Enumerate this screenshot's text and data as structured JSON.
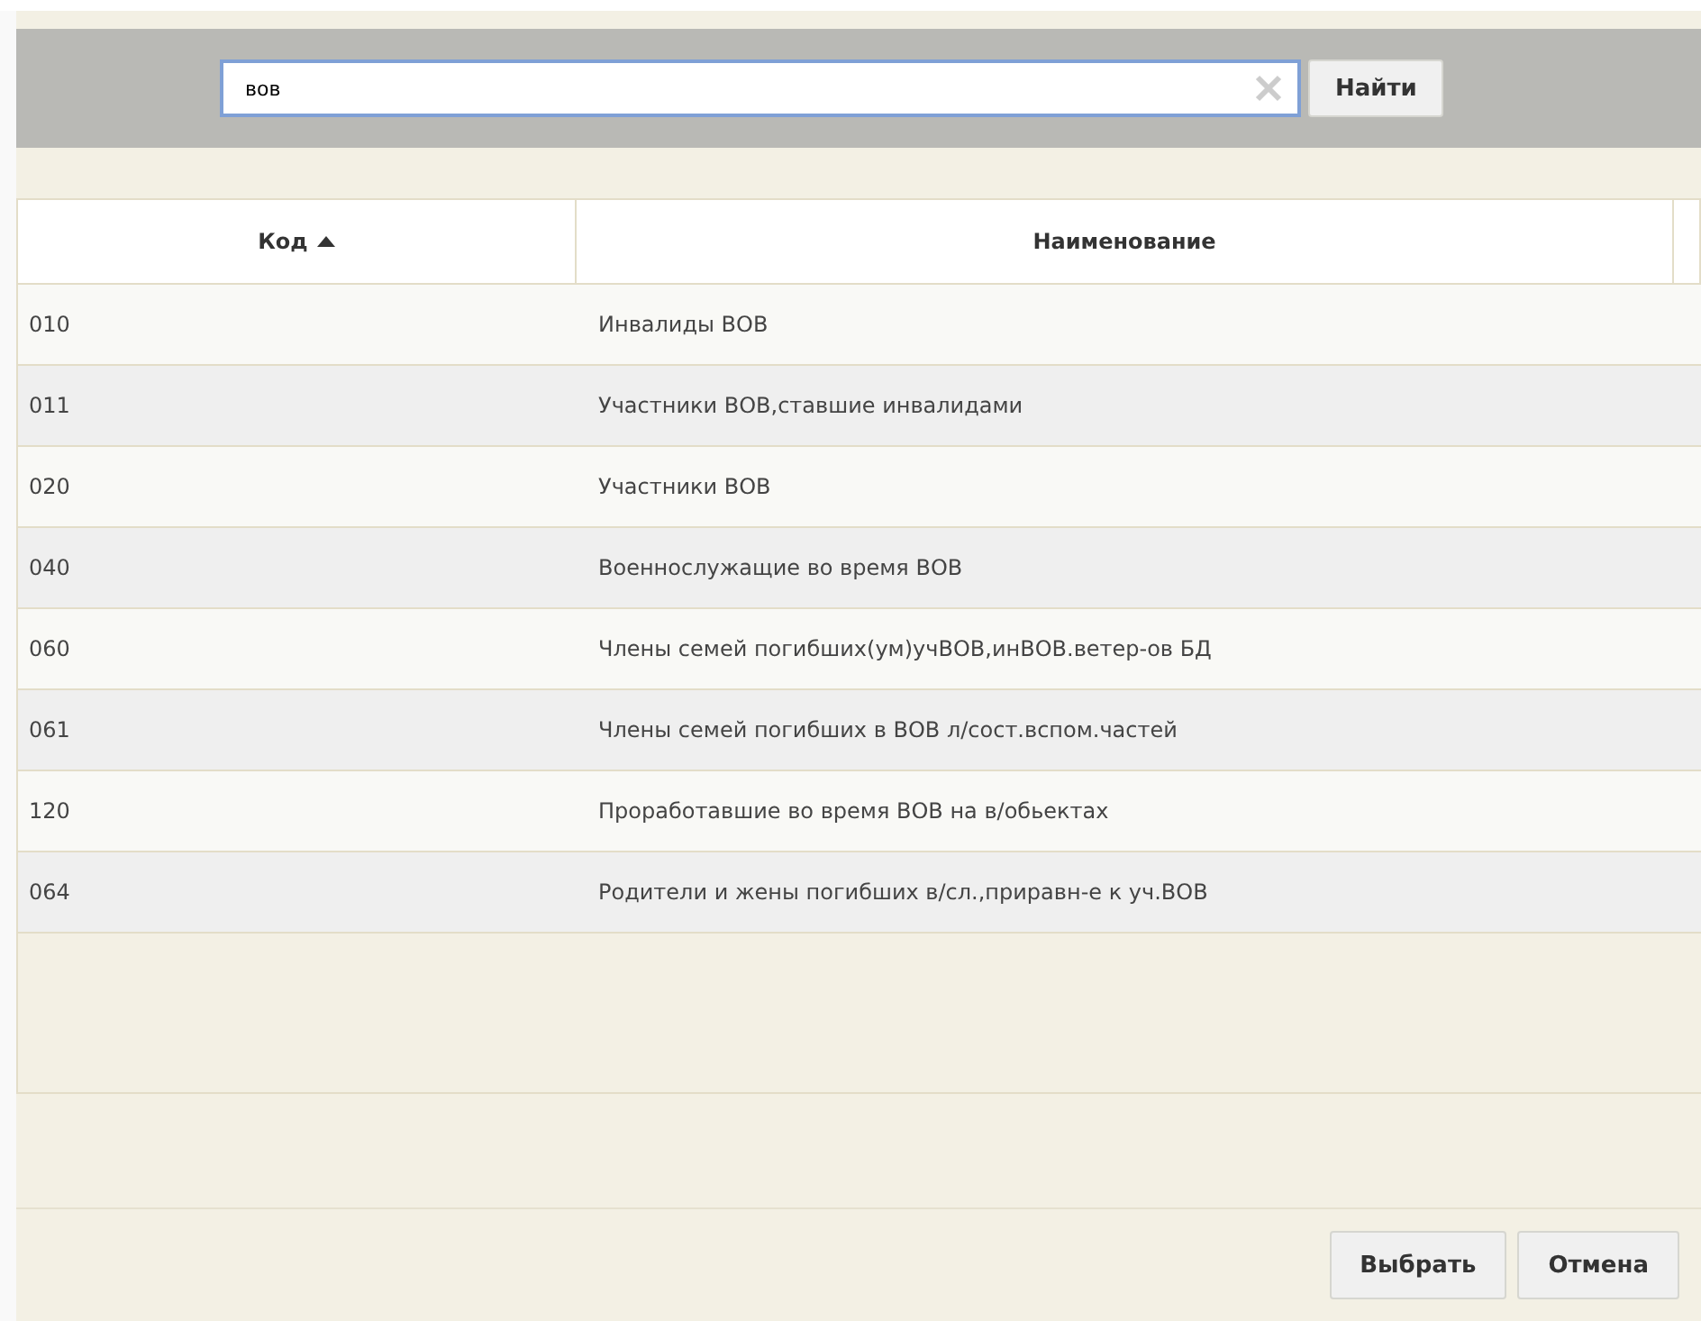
{
  "search": {
    "value": "вов",
    "button": "Найти"
  },
  "table": {
    "columns": [
      {
        "label": "Код",
        "sorted": true
      },
      {
        "label": "Наименование",
        "sorted": false
      }
    ],
    "rows": [
      {
        "code": "010",
        "name": "Инвалиды ВОВ"
      },
      {
        "code": "011",
        "name": "Участники ВОВ,ставшие инвалидами"
      },
      {
        "code": "020",
        "name": "Участники ВОВ"
      },
      {
        "code": "040",
        "name": "Военнослужащие во время ВОВ"
      },
      {
        "code": "060",
        "name": "Члены семей погибших(ум)учВОВ,инВОВ.ветер-ов БД"
      },
      {
        "code": "061",
        "name": "Члены семей погибших в ВОВ л/сост.вспом.частей"
      },
      {
        "code": "120",
        "name": "Проработавшие во время ВОВ на в/обьектах"
      },
      {
        "code": "064",
        "name": "Родители и жены погибших в/сл.,приравн-е к уч.ВОВ"
      }
    ]
  },
  "buttons": [
    "Выбрать",
    "Отмена"
  ]
}
